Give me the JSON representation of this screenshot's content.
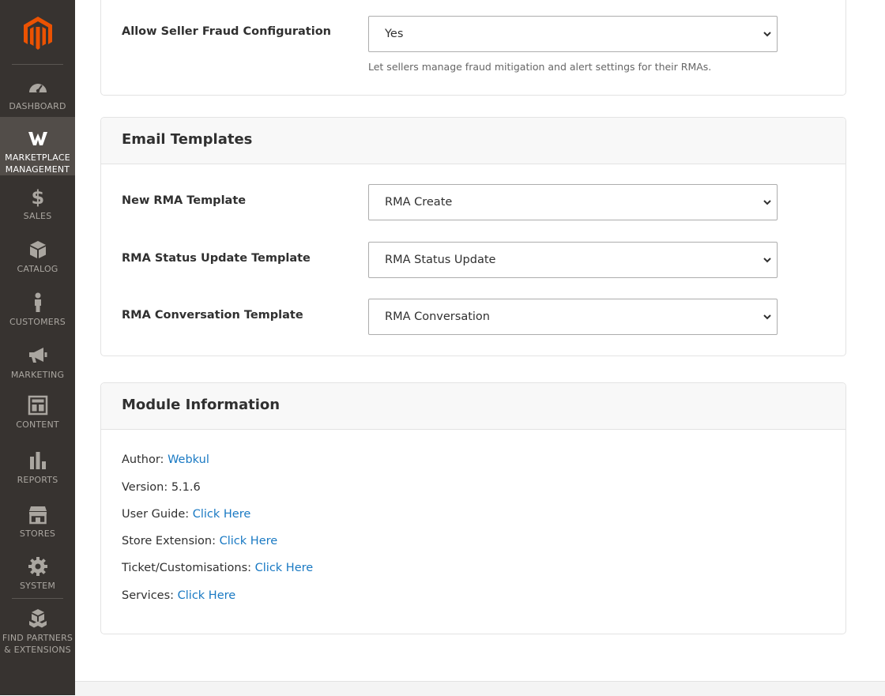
{
  "sidebar": {
    "items": [
      {
        "label": "DASHBOARD",
        "icon": "dashboard-icon"
      },
      {
        "label_line1": "MARKETPLACE",
        "label_line2": "MANAGEMENT",
        "icon": "webkul-icon"
      },
      {
        "label": "SALES",
        "icon": "dollar-icon"
      },
      {
        "label": "CATALOG",
        "icon": "box-icon"
      },
      {
        "label": "CUSTOMERS",
        "icon": "person-icon"
      },
      {
        "label": "MARKETING",
        "icon": "megaphone-icon"
      },
      {
        "label": "CONTENT",
        "icon": "layout-icon"
      },
      {
        "label": "REPORTS",
        "icon": "bar-chart-icon"
      },
      {
        "label": "STORES",
        "icon": "storefront-icon"
      },
      {
        "label": "SYSTEM",
        "icon": "gear-icon"
      },
      {
        "label_line1": "FIND PARTNERS",
        "label_line2": "& EXTENSIONS",
        "icon": "boxes-icon"
      }
    ]
  },
  "fraud": {
    "label": "Allow Seller Fraud Configuration",
    "value": "Yes",
    "note": "Let sellers manage fraud mitigation and alert settings for their RMAs."
  },
  "email_templates": {
    "title": "Email Templates",
    "rows": [
      {
        "label": "New RMA Template",
        "value": "RMA Create"
      },
      {
        "label": "RMA Status Update Template",
        "value": "RMA Status Update"
      },
      {
        "label": "RMA Conversation Template",
        "value": "RMA Conversation"
      }
    ]
  },
  "module_info": {
    "title": "Module Information",
    "author_label": "Author:",
    "author_link": "Webkul",
    "version_text": "Version: 5.1.6",
    "user_guide_label": "User Guide:",
    "store_extension_label": "Store Extension:",
    "ticket_label": "Ticket/Customisations:",
    "services_label": "Services:",
    "link_text": "Click Here"
  },
  "colors": {
    "sidebar_bg": "#373330",
    "sidebar_active": "#524d49",
    "brand_orange": "#eb5202",
    "link_blue": "#1979c3"
  }
}
